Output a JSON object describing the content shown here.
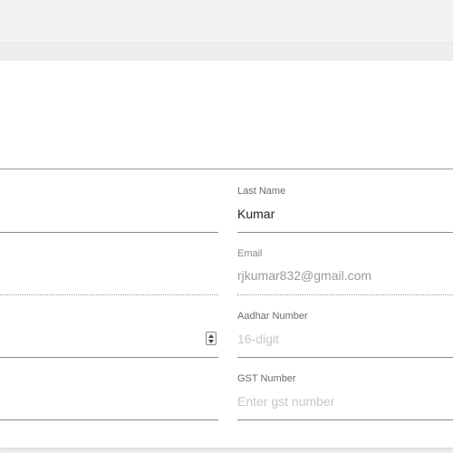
{
  "form": {
    "last_name": {
      "label": "Last Name",
      "value": "Kumar"
    },
    "email": {
      "label": "Email",
      "value": "rjkumar832@gmail.com"
    },
    "aadhar": {
      "label": "Aadhar Number",
      "placeholder": "16-digit"
    },
    "gst": {
      "label": "GST Number",
      "placeholder": "Enter gst number"
    }
  }
}
